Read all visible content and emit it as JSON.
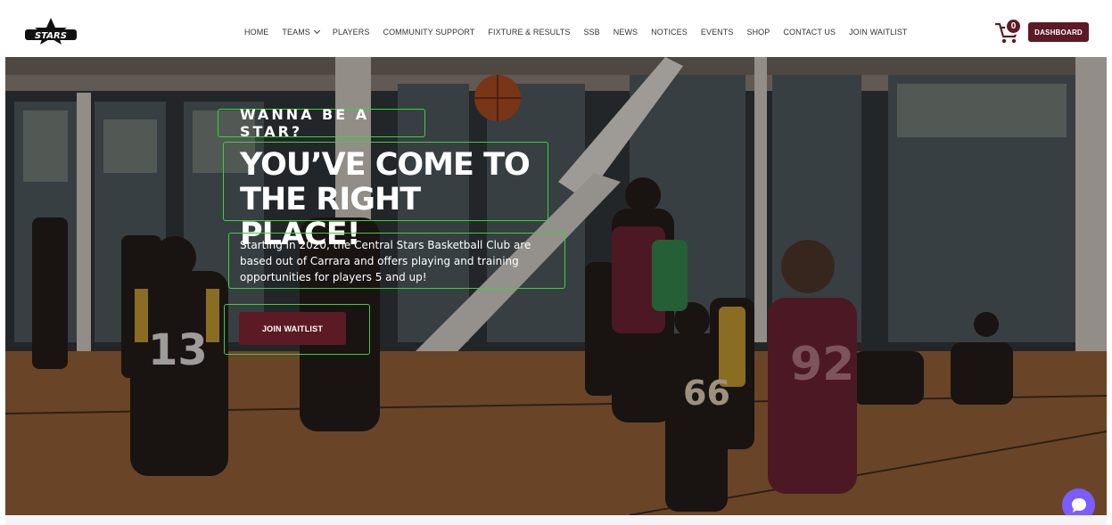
{
  "header": {
    "logo_text": "STARS",
    "nav": [
      {
        "label": "HOME"
      },
      {
        "label": "TEAMS",
        "has_dropdown": true
      },
      {
        "label": "PLAYERS"
      },
      {
        "label": "COMMUNITY SUPPORT"
      },
      {
        "label": "FIXTURE & RESULTS"
      },
      {
        "label": "SSB"
      },
      {
        "label": "NEWS"
      },
      {
        "label": "NOTICES"
      },
      {
        "label": "EVENTS"
      },
      {
        "label": "SHOP"
      },
      {
        "label": "CONTACT US"
      },
      {
        "label": "JOIN WAITLIST"
      }
    ],
    "cart_count": "0",
    "dashboard_label": "DASHBOARD"
  },
  "hero": {
    "eyebrow": "WANNA BE A STAR?",
    "headline_line1": "YOU’VE COME TO",
    "headline_line2": "THE RIGHT PLACE!",
    "description": "Starting in 2020, the Central Stars Basketball Club are based out of Carrara and offers playing and training opportunities for players 5 and up!",
    "cta_label": "JOIN WAITLIST",
    "jersey_numbers": [
      "13",
      "92",
      "66"
    ]
  },
  "colors": {
    "brand": "#5b1a24",
    "highlight_outline": "#3ad23a",
    "chat": "#7b5cff"
  },
  "icons": {
    "cart": "shopping-cart-icon",
    "chat": "chat-bubble-icon",
    "logo": "stars-logo"
  }
}
